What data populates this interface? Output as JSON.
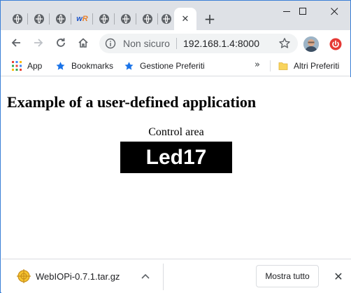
{
  "browser": {
    "tabs": [
      {
        "icon": "globe-icon"
      },
      {
        "icon": "globe-icon"
      },
      {
        "icon": "globe-icon"
      },
      {
        "icon": "wr-logo-icon",
        "logo_text": "wR"
      },
      {
        "icon": "globe-icon"
      },
      {
        "icon": "globe-icon"
      },
      {
        "icon": "globe-icon"
      },
      {
        "icon": "globe-icon"
      },
      {
        "icon": "globe-icon",
        "active": true,
        "close_glyph": "✕"
      }
    ],
    "new_tab_glyph": "+",
    "window_controls": {
      "minimize": "—",
      "maximize": "☐",
      "close": "✕"
    },
    "address": {
      "security_text": "Non sicuro",
      "url": "192.168.1.4:8000"
    },
    "bookmarks": [
      {
        "label": "App",
        "icon": "apps-grid-icon"
      },
      {
        "label": "Bookmarks",
        "icon": "star-icon"
      },
      {
        "label": "Gestione Preferiti",
        "icon": "star-icon"
      }
    ],
    "bookmarks_overflow": "»",
    "other_bookmarks": {
      "label": "Altri Preferiti",
      "icon": "folder-icon"
    }
  },
  "page": {
    "title": "Example of a user-defined application",
    "control_label": "Control area",
    "led_button_label": "Led17"
  },
  "downloads": {
    "file_name": "WebIOPi-0.7.1.tar.gz",
    "show_all_label": "Mostra tutto",
    "close_glyph": "✕"
  },
  "colors": {
    "accent": "#1a73e8",
    "tab_strip": "#dee1e6",
    "led_button_bg": "#000000",
    "led_button_text": "#ffffff"
  }
}
